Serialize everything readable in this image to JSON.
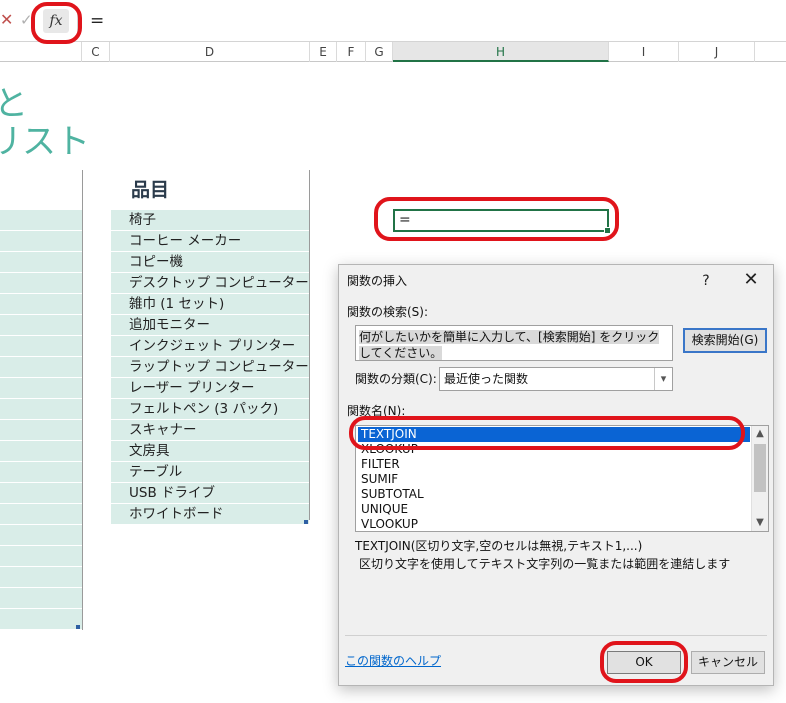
{
  "formula_bar": {
    "cancel_glyph": "✕",
    "enter_glyph": "✓",
    "fx_label": "fx",
    "formula": "="
  },
  "columns": [
    {
      "label": "C"
    },
    {
      "label": "D"
    },
    {
      "label": "E"
    },
    {
      "label": "F"
    },
    {
      "label": "G"
    },
    {
      "label": "H",
      "selected": true
    },
    {
      "label": "I"
    },
    {
      "label": "J"
    }
  ],
  "sheet": {
    "title_line1": "と",
    "title_line2": "リスト",
    "list_header": "品目",
    "items": [
      "椅子",
      "コーヒー メーカー",
      "コピー機",
      "デスクトップ コンピューター",
      "雑巾 (1 セット)",
      "追加モニター",
      "インクジェット プリンター",
      "ラップトップ コンピューター",
      "レーザー プリンター",
      "フェルトペン (3 パック)",
      "スキャナー",
      "文房具",
      "テーブル",
      "USB ドライブ",
      "ホワイトボード"
    ],
    "active_cell_value": "="
  },
  "dialog": {
    "title": "関数の挿入",
    "help": "?",
    "close": "✕",
    "search_label": "関数の検索(S):",
    "search_value": "何がしたいかを簡単に入力して、[検索開始] をクリックしてください。",
    "go_button": "検索開始(G)",
    "category_label": "関数の分類(C):",
    "category_value": "最近使った関数",
    "function_list_label": "関数名(N):",
    "functions": [
      "TEXTJOIN",
      "XLOOKUP",
      "FILTER",
      "SUMIF",
      "SUBTOTAL",
      "UNIQUE",
      "VLOOKUP"
    ],
    "selected_function": "TEXTJOIN",
    "syntax": "TEXTJOIN(区切り文字,空のセルは無視,テキスト1,...)",
    "description": "区切り文字を使用してテキスト文字列の一覧または範囲を連結します",
    "help_link": "この関数のヘルプ",
    "ok_button": "OK",
    "cancel_button": "キャンセル"
  },
  "colors": {
    "accent_green": "#217346",
    "title_teal": "#4fb3a1",
    "band_fill": "#d9ede8",
    "annotation_red": "#e0141b",
    "selection_blue": "#0a64d4"
  }
}
